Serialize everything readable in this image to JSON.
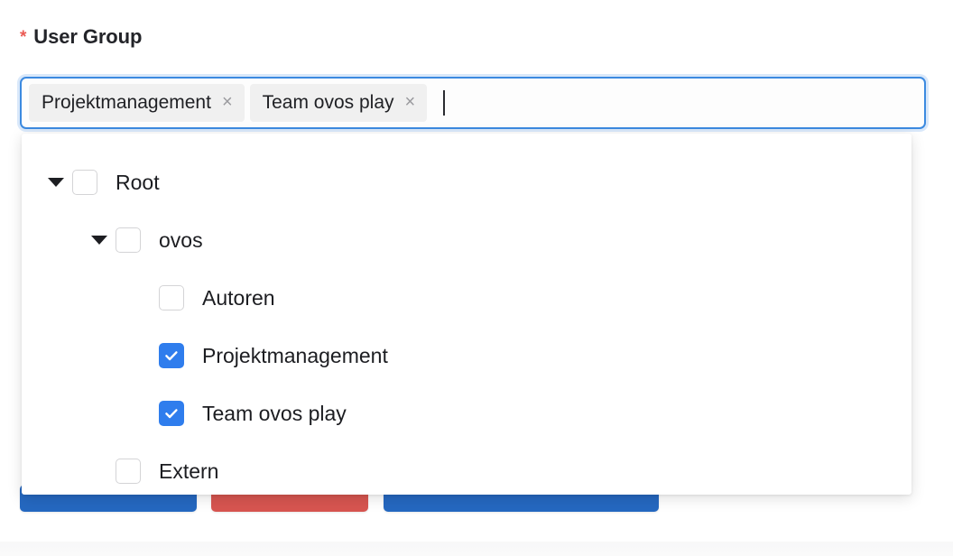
{
  "field": {
    "required_marker": "*",
    "label": "User Group"
  },
  "select": {
    "tags": [
      {
        "label": "Projektmanagement",
        "remove_icon": "close-icon",
        "remove_glyph": "×"
      },
      {
        "label": "Team ovos play",
        "remove_icon": "close-icon",
        "remove_glyph": "×"
      }
    ],
    "input_value": "",
    "placeholder": "",
    "caret_visible": true,
    "focused": true,
    "focus_border_color": "#3c8ae0"
  },
  "dropdown": {
    "visible": true,
    "tree": [
      {
        "label": "Root",
        "level": 0,
        "expandable": true,
        "expanded": true,
        "checked": false,
        "arrow_icon": "caret-down-icon"
      },
      {
        "label": "ovos",
        "level": 1,
        "expandable": true,
        "expanded": true,
        "checked": false,
        "arrow_icon": "caret-down-icon"
      },
      {
        "label": "Autoren",
        "level": 2,
        "expandable": false,
        "expanded": false,
        "checked": false,
        "arrow_icon": ""
      },
      {
        "label": "Projektmanagement",
        "level": 2,
        "expandable": false,
        "expanded": false,
        "checked": true,
        "arrow_icon": ""
      },
      {
        "label": "Team ovos play",
        "level": 2,
        "expandable": false,
        "expanded": false,
        "checked": true,
        "arrow_icon": ""
      },
      {
        "label": "Extern",
        "level": 1,
        "expandable": false,
        "expanded": false,
        "checked": false,
        "arrow_icon": ""
      }
    ],
    "checked_color": "#2f7ded"
  },
  "footer_buttons": [
    {
      "label": "",
      "style": "primary",
      "color": "#2568c0"
    },
    {
      "label": "",
      "style": "danger",
      "color": "#d75550"
    },
    {
      "label": "",
      "style": "primary",
      "color": "#2568c0"
    }
  ]
}
